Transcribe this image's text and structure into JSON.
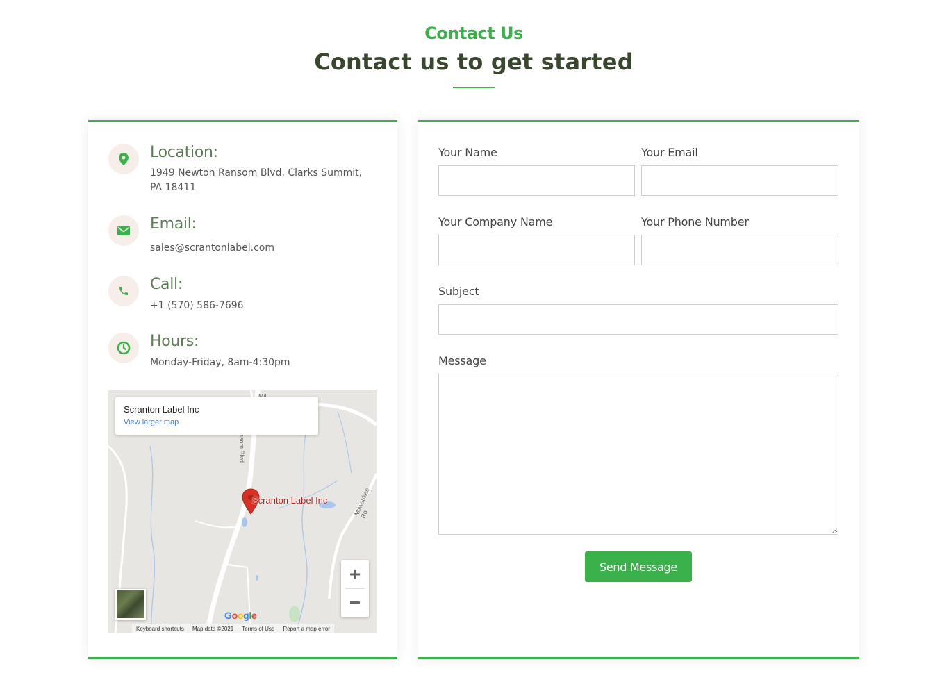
{
  "header": {
    "subtitle": "Contact Us",
    "title": "Contact us to get started"
  },
  "contact_info": {
    "location": {
      "label": "Location:",
      "text": "1949 Newton Ransom Blvd, Clarks Summit, PA 18411",
      "icon": "map-pin-icon"
    },
    "email": {
      "label": "Email:",
      "text": "sales@scrantonlabel.com",
      "icon": "envelope-icon"
    },
    "call": {
      "label": "Call:",
      "text": "+1 (570) 586-7696",
      "icon": "phone-icon"
    },
    "hours": {
      "label": "Hours:",
      "text": "Monday-Friday, 8am-4:30pm",
      "icon": "clock-icon"
    }
  },
  "map": {
    "place_name": "Scranton Label Inc",
    "view_larger": "View larger map",
    "pin_label": "Scranton Label Inc",
    "road_label_1": "Newton Ransom Blvd",
    "road_label_1_visible": "nsom Blvd",
    "road_label_2": "Milwaukee Rd",
    "road_label_2_visible": "Milwaukee Ro",
    "road_label_3": "Mil",
    "zoom_in": "+",
    "zoom_out": "−",
    "google": "Google",
    "footer": {
      "shortcuts": "Keyboard shortcuts",
      "map_data": "Map data ©2021",
      "terms": "Terms of Use",
      "report": "Report a map error"
    }
  },
  "form": {
    "name_label": "Your Name",
    "email_label": "Your Email",
    "company_label": "Your Company Name",
    "phone_label": "Your Phone Number",
    "subject_label": "Subject",
    "message_label": "Message",
    "name_value": "",
    "email_value": "",
    "company_value": "",
    "phone_value": "",
    "subject_value": "",
    "message_value": "",
    "submit_label": "Send Message"
  },
  "colors": {
    "accent": "#3ab14b",
    "title": "#39472f",
    "info_heading": "#5d7d57",
    "icon_bg": "#f7eee9"
  }
}
